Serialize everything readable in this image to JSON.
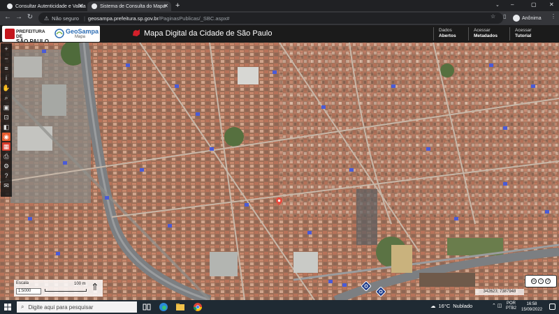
{
  "browser": {
    "tabs": [
      {
        "title": "Consultar Autenticidade e Valida",
        "active": false
      },
      {
        "title": "Sistema de Consulta do Mapa",
        "active": true
      }
    ],
    "new_tab_label": "+",
    "window_controls": [
      "–",
      "▢",
      "✕"
    ],
    "address": {
      "security_label": "Não seguro",
      "host": "geosampa.prefeitura.sp.gov.br",
      "path": "/PaginasPublicas/_SBC.aspx#"
    },
    "profile_label": "Anônima"
  },
  "header": {
    "prefeitura_line1": "PREFEITURA DE",
    "prefeitura_line2": "SÃO PAULO",
    "geosampa_title": "GeoSampa",
    "geosampa_sub": "Mapa",
    "map_title": "Mapa Digital da Cidade de São Paulo",
    "links": [
      {
        "line1": "Dados",
        "line2": "Abertos"
      },
      {
        "line1": "Acessar",
        "line2": "Metadados"
      },
      {
        "line1": "Acessar",
        "line2": "Tutorial"
      }
    ]
  },
  "map": {
    "scale_label": "Escala",
    "scale_value": "1:5000",
    "scale_bar_text": "100 m",
    "coordinates": "342623; 7387948",
    "pin_color": "#e84a3d",
    "accent": "#e65b2e"
  },
  "toolbar_tools": [
    {
      "icon": "plus-icon",
      "glyph": "+"
    },
    {
      "icon": "minus-icon",
      "glyph": "−"
    },
    {
      "icon": "layers-icon",
      "glyph": "≡"
    },
    {
      "icon": "info-icon",
      "glyph": "i"
    },
    {
      "icon": "pan-hand-icon",
      "glyph": "✋"
    },
    {
      "icon": "zoom-icon",
      "glyph": "⌕"
    },
    {
      "icon": "select-icon",
      "glyph": "▣"
    },
    {
      "icon": "measure-icon",
      "glyph": "⊡"
    },
    {
      "icon": "draw-icon",
      "glyph": "◧"
    },
    {
      "icon": "orange-tool-icon",
      "glyph": "◉"
    },
    {
      "icon": "red-tool-icon",
      "glyph": "▦"
    },
    {
      "icon": "print-icon",
      "glyph": "⎙"
    },
    {
      "icon": "settings-icon",
      "glyph": "⚙"
    },
    {
      "icon": "help-icon",
      "glyph": "?"
    },
    {
      "icon": "mail-icon",
      "glyph": "✉"
    }
  ],
  "taskbar": {
    "search_placeholder": "Digite aqui para pesquisar",
    "weather_temp": "16°C",
    "weather_desc": "Nublado",
    "lang_line1": "POR",
    "lang_line2": "PTB2",
    "time": "16:58",
    "date": "15/09/2022"
  }
}
